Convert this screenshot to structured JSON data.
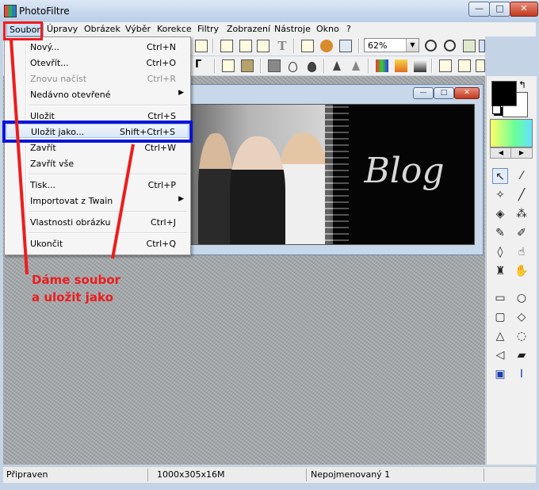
{
  "window": {
    "title": "PhotoFiltre",
    "min_label": "—",
    "max_label": "□",
    "close_label": "✕"
  },
  "menubar": {
    "items": [
      "Soubor",
      "Úpravy",
      "Obrázek",
      "Výběr",
      "Korekce",
      "Filtry",
      "Zobrazení",
      "Nástroje",
      "Okno",
      "?"
    ]
  },
  "toolbar": {
    "zoom_value": "62%",
    "zoom_arrow": "▼"
  },
  "file_menu": {
    "new": {
      "label": "Nový...",
      "shortcut": "Ctrl+N"
    },
    "open": {
      "label": "Otevřít...",
      "shortcut": "Ctrl+O"
    },
    "reload": {
      "label": "Znovu načíst",
      "shortcut": "Ctrl+R",
      "disabled": true
    },
    "recent": {
      "label": "Nedávno otevřené",
      "submenu_arrow": "▶"
    },
    "save": {
      "label": "Uložit",
      "shortcut": "Ctrl+S"
    },
    "save_as": {
      "label": "Uložit jako...",
      "shortcut": "Shift+Ctrl+S"
    },
    "close": {
      "label": "Zavřít",
      "shortcut": "Ctrl+W"
    },
    "close_all": {
      "label": "Zavřít vše"
    },
    "print": {
      "label": "Tisk...",
      "shortcut": "Ctrl+P"
    },
    "twain": {
      "label": "Importovat z Twain",
      "submenu_arrow": "▶"
    },
    "properties": {
      "label": "Vlastnosti obrázku",
      "shortcut": "Ctrl+J"
    },
    "exit": {
      "label": "Ukončit",
      "shortcut": "Ctrl+Q"
    }
  },
  "image_window": {
    "min_label": "—",
    "max_label": "□",
    "close_label": "✕",
    "banner_text": "Blog"
  },
  "statusbar": {
    "status": "Připraven",
    "dimensions": "1000x305x16M",
    "filename": "Nepojmenovaný 1"
  },
  "tools": {
    "swap": "↰",
    "grad_left": "◀",
    "grad_right": "▶"
  },
  "annotation": {
    "line1": "Dáme soubor",
    "line2": "a uložit jako",
    "color": "#ee1c1c",
    "highlight_color": "#0a14d8"
  }
}
